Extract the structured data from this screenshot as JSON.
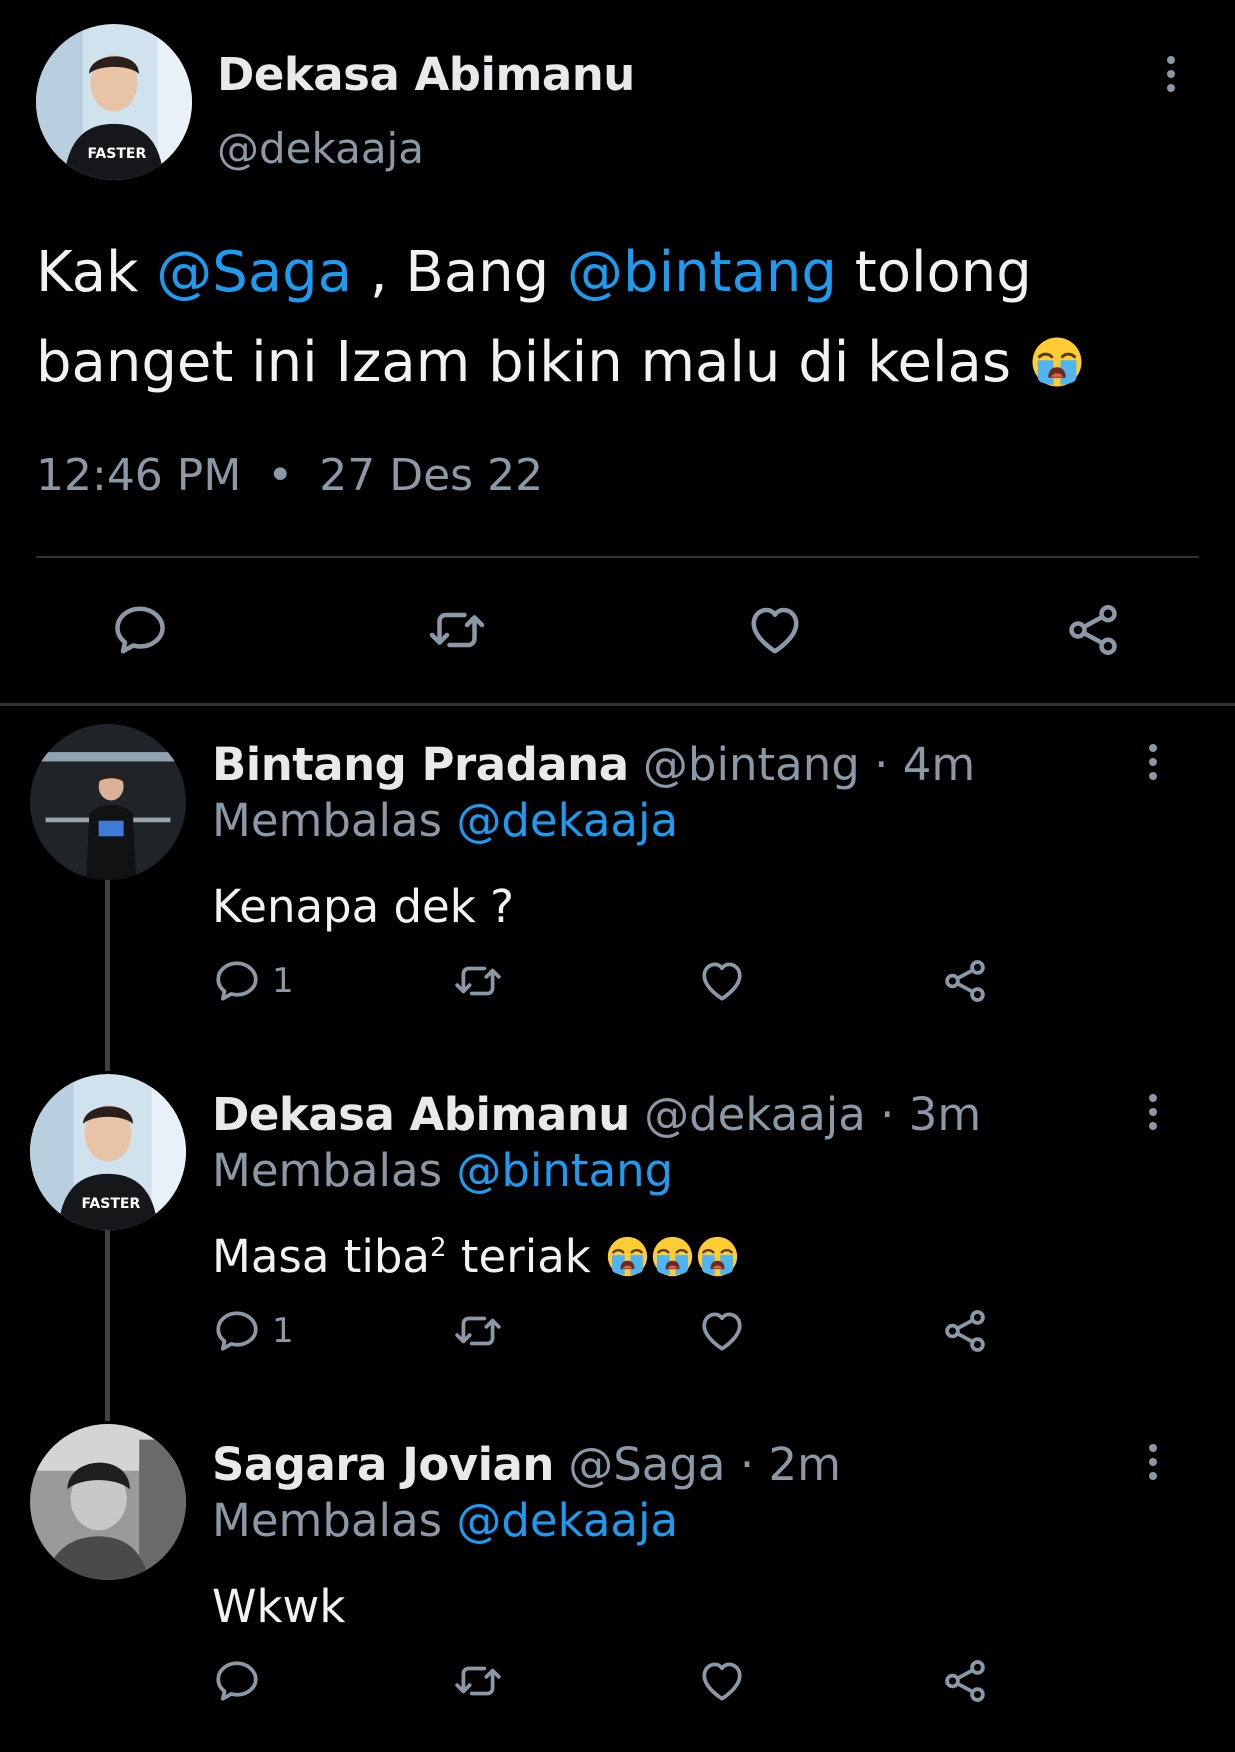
{
  "main_tweet": {
    "author_name": "Dekasa Abimanu",
    "author_handle": "@dekaaja",
    "text_parts": {
      "p1": "Kak ",
      "mention1": "@Saga",
      "p2": " , Bang ",
      "mention2": "@bintang",
      "p3": " tolong banget ini Izam bikin malu di kelas "
    },
    "emoji": "loudly-crying-face",
    "time": "12:46 PM",
    "date": "27 Des 22",
    "actions": [
      "reply-icon",
      "retweet-icon",
      "like-icon",
      "share-icon"
    ]
  },
  "replies": [
    {
      "name": "Bintang Pradana",
      "handle": "@bintang",
      "time": "4m",
      "replying_label": "Membalas",
      "replying_to": "@dekaaja",
      "text": "Kenapa dek ?",
      "reply_count": "1"
    },
    {
      "name": "Dekasa Abimanu",
      "handle": "@dekaaja",
      "time": "3m",
      "replying_label": "Membalas",
      "replying_to": "@bintang",
      "text_base": "Masa tiba",
      "text_sup": "2",
      "text_after": " teriak ",
      "emoji_count": 3,
      "reply_count": "1"
    },
    {
      "name": "Sagara Jovian",
      "handle": "@Saga",
      "time": "2m",
      "replying_label": "Membalas",
      "replying_to": "@dekaaja",
      "text": "Wkwk",
      "reply_count": ""
    }
  ],
  "separator": "·",
  "colors": {
    "background": "#000000",
    "text": "#e7e9ea",
    "secondary": "#8b98a5",
    "accent": "#1d9bf0",
    "divider": "#2f3336"
  }
}
